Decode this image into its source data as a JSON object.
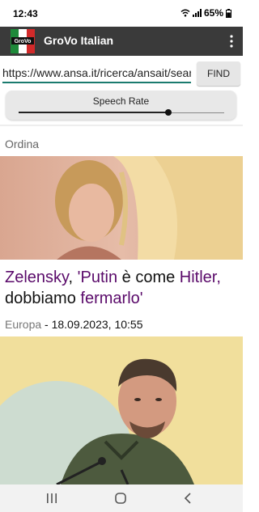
{
  "status": {
    "time": "12:43",
    "battery": "65%"
  },
  "app": {
    "title": "GroVo Italian",
    "logo_text": "GroVo"
  },
  "url": {
    "value": "https://www.ansa.it/ricerca/ansait/search.shtml"
  },
  "find": {
    "label": "FIND"
  },
  "speech": {
    "label": "Speech Rate",
    "value_fraction": 0.73
  },
  "feed": {
    "sort_label": "Ordina"
  },
  "article": {
    "headline_parts": [
      "Zelensky",
      ", ",
      "'Putin",
      " è come ",
      "Hitler",
      ",",
      " dobbiamo ",
      "fermarlo",
      "'"
    ],
    "category": "Europa",
    "date": " - 18.09.2023, 10:55"
  },
  "colors": {
    "appbar": "#3a3a3a",
    "link": "#5a0a6a",
    "url_underline": "#1b7b6f"
  },
  "icons": [
    "wifi-icon",
    "signal-icon",
    "battery-icon",
    "overflow-menu-icon",
    "recents-icon",
    "home-icon",
    "back-icon"
  ]
}
